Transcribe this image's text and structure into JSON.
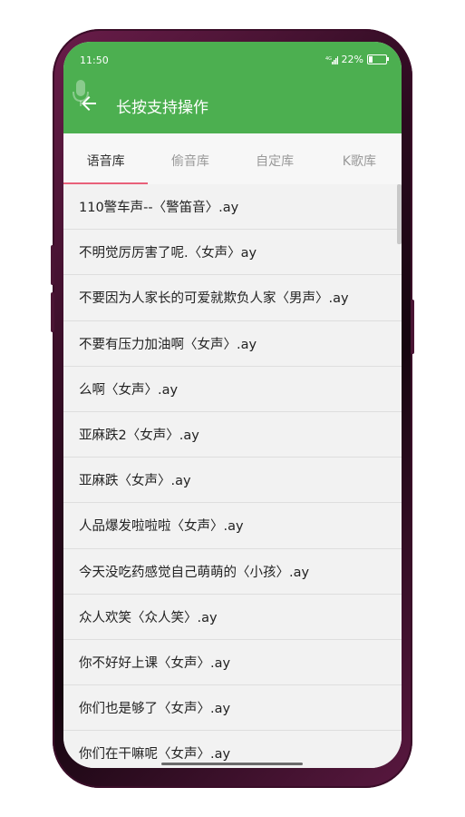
{
  "status": {
    "time": "11:50",
    "network": "4G",
    "battery": "22%",
    "battery_level": 0.22
  },
  "appbar": {
    "title": "长按支持操作",
    "color": "#4caf50"
  },
  "tabs": [
    {
      "label": "语音库",
      "active": true
    },
    {
      "label": "偷音库",
      "active": false
    },
    {
      "label": "自定库",
      "active": false
    },
    {
      "label": "K歌库",
      "active": false
    }
  ],
  "accent": "#e8617a",
  "items": [
    "110警车声--〈警笛音〉.ay",
    "不明觉厉厉害了呢.〈女声〉ay",
    "不要因为人家长的可爱就欺负人家〈男声〉.ay",
    "不要有压力加油啊〈女声〉.ay",
    "么啊〈女声〉.ay",
    "亚麻跌2〈女声〉.ay",
    "亚麻跌〈女声〉.ay",
    "人品爆发啦啦啦〈女声〉.ay",
    "今天没吃药感觉自己萌萌的〈小孩〉.ay",
    "众人欢笑〈众人笑〉.ay",
    "你不好好上课〈女声〉.ay",
    "你们也是够了〈女声〉.ay",
    "你们在干嘛呢〈女声〉.ay"
  ],
  "icons": {
    "back": "arrow-left-icon",
    "mic": "microphone-icon"
  }
}
